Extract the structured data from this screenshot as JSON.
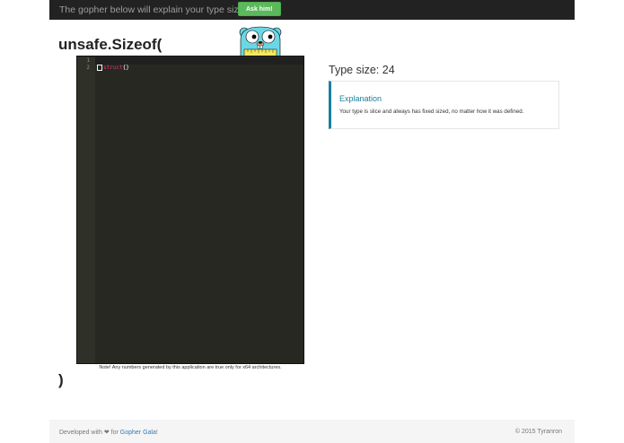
{
  "navbar": {
    "prompt": "The gopher below will explain your type size...",
    "ask_button": "Ask him!"
  },
  "page": {
    "open_heading": "unsafe.Sizeof(",
    "close_heading": ")",
    "note": "Note! Any numbers generated by this application are true only for x64 architectures."
  },
  "editor": {
    "line_numbers": [
      "1",
      "2"
    ],
    "line2_keyword": "struct",
    "line2_rest": "{}"
  },
  "result": {
    "type_size": "Type size: 24",
    "explanation_title": "Explanation",
    "explanation_text": "Your type is slice and always has fixed sized, no matter how it was defined."
  },
  "footer": {
    "developed_prefix": "Developed with",
    "heart": "❤",
    "for_text": "for",
    "link_text": "Gopher Gala",
    "link_suffix": "!",
    "copyright": "© 2015 Tyranron"
  },
  "colors": {
    "navbar_bg": "#222222",
    "ask_button_bg": "#5cb85c",
    "editor_bg": "#272822",
    "keyword": "#f92672",
    "explanation_accent": "#1b809e",
    "gopher_body": "#6ad7e5"
  },
  "icons": {
    "mascot": "gopher-mascot-icon"
  }
}
